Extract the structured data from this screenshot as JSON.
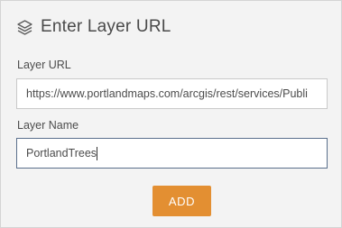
{
  "header": {
    "icon": "layers-icon",
    "title": "Enter Layer URL"
  },
  "form": {
    "url_label": "Layer URL",
    "url_value": "https://www.portlandmaps.com/arcgis/rest/services/Publi",
    "name_label": "Layer Name",
    "name_value": "PortlandTrees"
  },
  "actions": {
    "add_label": "ADD"
  },
  "colors": {
    "background": "#f3f3f3",
    "accent": "#e38f32",
    "focus_border": "#5a6f8c"
  }
}
